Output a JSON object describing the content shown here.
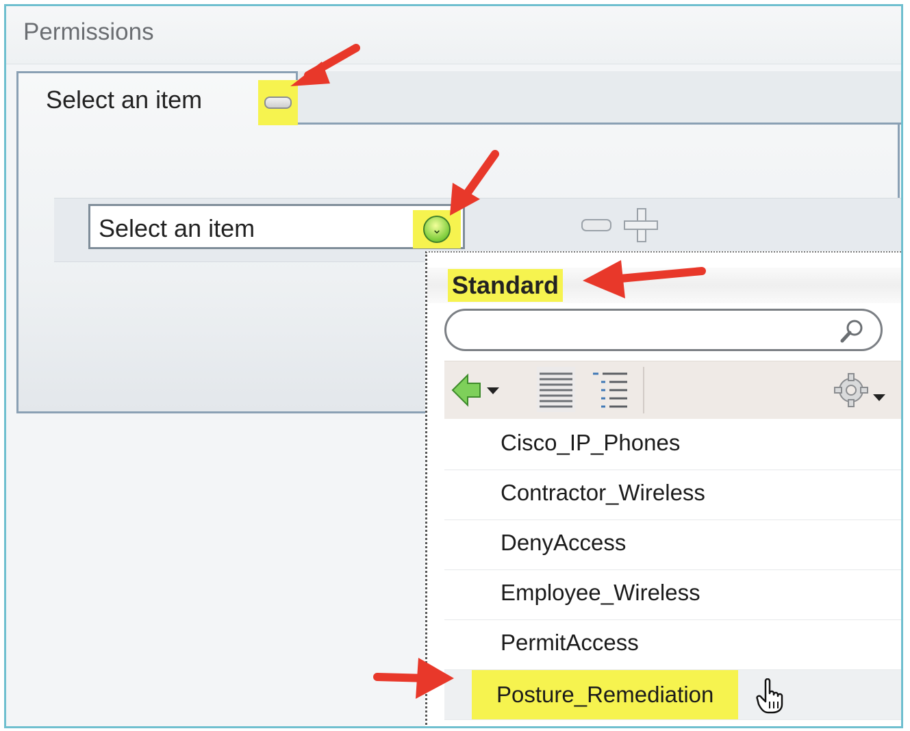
{
  "header": {
    "title": "Permissions"
  },
  "outer_select": {
    "label": "Select an item",
    "collapse_icon": "minus-pill-icon"
  },
  "inner_select": {
    "label": "Select an item",
    "dropdown_icon": "chevron-down-circle-icon"
  },
  "row_actions": {
    "remove_icon": "minus-icon",
    "add_icon": "plus-icon"
  },
  "dropdown": {
    "title": "Standard",
    "search": {
      "value": "",
      "icon": "search-icon"
    },
    "toolbar": {
      "back_icon": "back-arrow-icon",
      "list_icon": "list-view-icon",
      "tree_icon": "tree-view-icon",
      "settings_icon": "gear-icon"
    },
    "items": [
      {
        "label": "Cisco_IP_Phones"
      },
      {
        "label": "Contractor_Wireless"
      },
      {
        "label": "DenyAccess"
      },
      {
        "label": "Employee_Wireless"
      },
      {
        "label": "PermitAccess"
      },
      {
        "label": "Posture_Remediation",
        "selected": true
      }
    ]
  },
  "colors": {
    "highlight": "#f6f34f",
    "annotation_arrow": "#e8382a",
    "frame_border": "#6fbfcf"
  }
}
